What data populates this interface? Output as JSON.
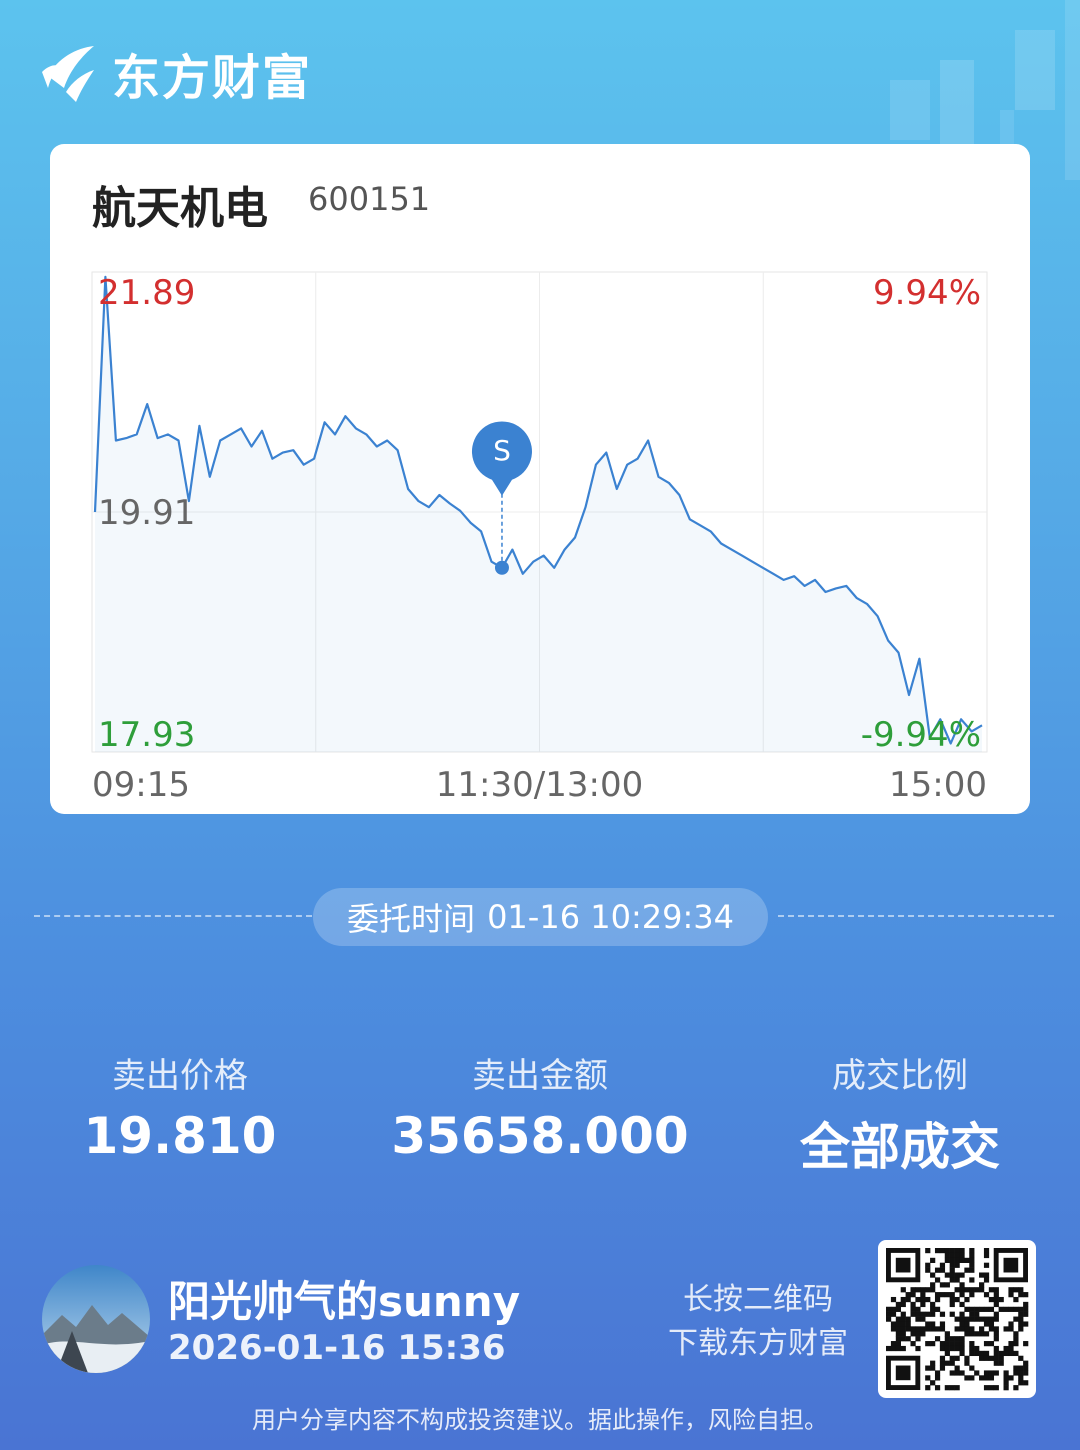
{
  "brand": {
    "name": "东方财富",
    "logo_icon": "eastmoney-logo-icon"
  },
  "stock": {
    "name": "航天机电",
    "code": "600151"
  },
  "chart_data": {
    "type": "line",
    "y_labels": {
      "high": "21.89",
      "mid": "19.91",
      "low": "17.93"
    },
    "pct_labels": {
      "high": "9.94%",
      "low": "-9.94%"
    },
    "ylim": [
      17.93,
      21.89
    ],
    "x_ticks": [
      "09:15",
      "11:30/13:00",
      "15:00"
    ],
    "grid": true,
    "colors": {
      "line": "#3b82d1",
      "up": "#d32f2f",
      "down": "#2e9e3a",
      "mid": "#666666"
    },
    "series": [
      {
        "values": [
          19.91,
          21.85,
          20.5,
          20.52,
          20.55,
          20.8,
          20.52,
          20.55,
          20.5,
          20.0,
          20.62,
          20.2,
          20.5,
          20.55,
          20.6,
          20.45,
          20.58,
          20.35,
          20.4,
          20.42,
          20.3,
          20.35,
          20.65,
          20.55,
          20.7,
          20.6,
          20.55,
          20.45,
          20.5,
          20.42,
          20.1,
          20.0,
          19.95,
          20.05,
          19.98,
          19.92,
          19.82,
          19.75,
          19.5,
          19.45,
          19.6,
          19.4,
          19.5,
          19.55,
          19.45,
          19.6,
          19.7,
          19.95,
          20.3,
          20.4,
          20.1,
          20.3,
          20.35,
          20.5,
          20.2,
          20.15,
          20.05,
          19.85,
          19.8,
          19.75,
          19.65,
          19.6,
          19.55,
          19.5,
          19.45,
          19.4,
          19.35,
          19.38,
          19.3,
          19.35,
          19.25,
          19.28,
          19.3,
          19.2,
          19.15,
          19.05,
          18.85,
          18.75,
          18.4,
          18.7,
          18.05,
          18.2,
          18.0,
          18.2,
          18.1,
          18.15
        ]
      }
    ]
  },
  "order_time": {
    "label": "委托时间",
    "value": "01-16 10:29:34"
  },
  "stats": [
    {
      "label": "卖出价格",
      "value": "19.810"
    },
    {
      "label": "卖出金额",
      "value": "35658.000"
    },
    {
      "label": "成交比例",
      "value": "全部成交"
    }
  ],
  "user": {
    "name": "阳光帅气的sunny",
    "time": "2026-01-16 15:36"
  },
  "qr_hint": {
    "line1": "长按二维码",
    "line2": "下载东方财富"
  },
  "disclaimer": "用户分享内容不构成投资建议。据此操作，风险自担。",
  "sell_marker": {
    "label": "S"
  }
}
